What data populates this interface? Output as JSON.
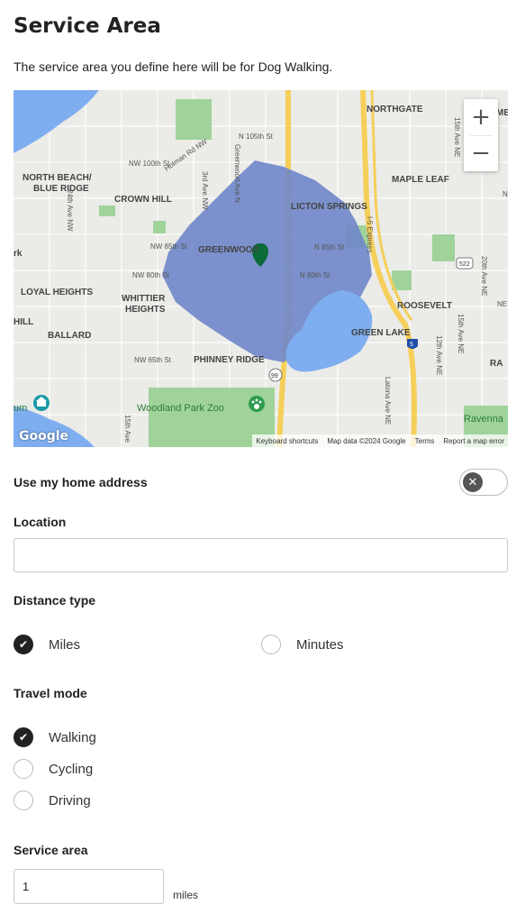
{
  "page": {
    "title": "Service Area",
    "subtitle": "The service area you define here will be for Dog Walking."
  },
  "map": {
    "labels": {
      "northgate": "NORTHGATE",
      "maple_leaf": "MAPLE LEAF",
      "north_beach": "NORTH BEACH/",
      "blue_ridge": "BLUE RIDGE",
      "crown_hill": "CROWN HILL",
      "licton_springs": "LICTON SPRINGS",
      "greenwood": "GREENWOOD",
      "loyal_heights": "LOYAL HEIGHTS",
      "whittier": "WHITTIER",
      "heights": "HEIGHTS",
      "roosevelt": "ROOSEVELT",
      "ballard": "BALLARD",
      "green_lake": "GREEN LAKE",
      "phinney_ridge": "PHINNEY RIDGE",
      "woodland_park_zoo": "Woodland Park Zoo",
      "ravenna": "Ravenna",
      "nw_105th": "N 105th St",
      "nw_100th": "NW 100th St",
      "holman": "Holman Rd NW",
      "greenwood_ave": "Greenwood Ave N",
      "third_ave": "3rd Ave NW",
      "twentyfourth": "24th Ave NW",
      "nw_85th": "NW 85th St",
      "n_85th": "N 85th St",
      "nw_80th": "NW 80th St",
      "n_80th": "N 80th St",
      "nw_65th": "NW 65th St",
      "i5_express": "I-5 Express",
      "fifteenth_ne": "15th Ave NE",
      "twentieth_ne": "20th Ave NE",
      "twelfth_ne": "12th Ave NE",
      "latona": "Latona Ave NE",
      "fifteenth_ave": "15th Ave",
      "route_522": "522",
      "route_99": "99",
      "route_5": "5",
      "edge_rk": "rk",
      "edge_hill": "HILL",
      "edge_um": "um",
      "edge_ra": "RA",
      "edge_ne": "NE",
      "edge_n": "N",
      "edge_me": "ME",
      "google": "Google"
    },
    "zoom_in": "+",
    "zoom_out": "−",
    "footer": {
      "shortcuts": "Keyboard shortcuts",
      "data": "Map data ©2024 Google",
      "terms": "Terms",
      "report": "Report a map error"
    },
    "colors": {
      "service_area": "#6f86c9",
      "water": "#7eaef0",
      "park": "#9fd39a",
      "marker": "#0b6b39"
    }
  },
  "home_address": {
    "label": "Use my home address",
    "toggle_icon": "close-icon"
  },
  "location": {
    "label": "Location",
    "value": "",
    "placeholder": ""
  },
  "distance_type": {
    "label": "Distance type",
    "options": [
      {
        "label": "Miles",
        "selected": true
      },
      {
        "label": "Minutes",
        "selected": false
      }
    ]
  },
  "travel_mode": {
    "label": "Travel mode",
    "options": [
      {
        "label": "Walking",
        "selected": true
      },
      {
        "label": "Cycling",
        "selected": false
      },
      {
        "label": "Driving",
        "selected": false
      }
    ]
  },
  "service_area": {
    "label": "Service area",
    "value": "1",
    "unit": "miles"
  }
}
